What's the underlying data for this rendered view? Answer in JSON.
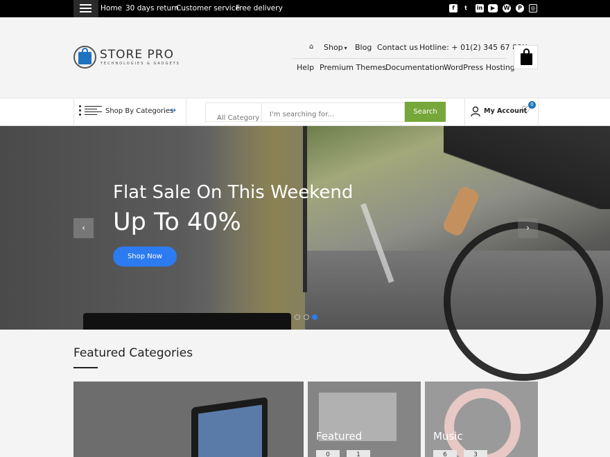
{
  "topbar": {
    "links": [
      "Home",
      "30 days return",
      "Customer service",
      "Free delivery"
    ],
    "social_icons": [
      "facebook-icon",
      "twitter-icon",
      "linkedin-icon",
      "youtube-icon",
      "wordpress-icon",
      "pinterest-icon",
      "instagram-icon"
    ],
    "social_glyphs": [
      "f",
      "t",
      "in",
      "▶",
      "W",
      "P",
      "◎"
    ]
  },
  "header": {
    "logo_name": "STORE PRO",
    "logo_tagline": "TECHNOLOGIES & GADGETS",
    "nav_primary": [
      "Shop",
      "Blog",
      "Contact us",
      "Hotline: + 01(2) 345 67 89X"
    ],
    "nav_secondary": [
      "Help",
      "Premium Themes",
      "Documentation",
      "WordPress Hosting"
    ]
  },
  "searchbar": {
    "categories_label": "Shop By Categories",
    "category_select": "All Category",
    "search_placeholder": "I'm searching for...",
    "search_button": "Search",
    "account_label": "My Account",
    "wishlist_count": "0"
  },
  "hero": {
    "line1": "Flat Sale On This Weekend",
    "line2": "Up To 40%",
    "cta": "Shop Now",
    "active_slide": 3,
    "slide_count": 3
  },
  "featured": {
    "heading": "Featured Categories",
    "cards": [
      {
        "title": ""
      },
      {
        "title": "Featured",
        "counts": [
          "0",
          "1"
        ]
      },
      {
        "title": "Music",
        "counts": [
          "6",
          "3"
        ]
      }
    ]
  },
  "colors": {
    "accent_blue": "#1e73be",
    "search_green": "#76a73a",
    "cta_blue": "#2d7bf0"
  }
}
